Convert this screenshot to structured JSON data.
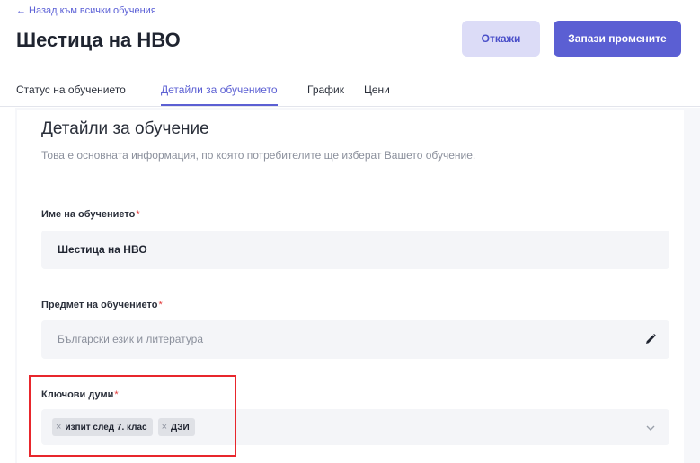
{
  "header": {
    "back_link": "← Назад към всички обучения",
    "title": "Шестица на НВО",
    "cancel_label": "Откажи",
    "save_label": "Запази промените"
  },
  "tabs": [
    {
      "label": "Статус на обучението",
      "active": false
    },
    {
      "label": "Детайли за обучението",
      "active": true
    },
    {
      "label": "График",
      "active": false
    },
    {
      "label": "Цени",
      "active": false
    }
  ],
  "section": {
    "title": "Детайли за обучение",
    "description": "Това е основната информация, по която потребителите ще изберат Вашето обучение."
  },
  "fields": {
    "name": {
      "label": "Име на обучението",
      "required_mark": "*",
      "value": "Шестица на НВО"
    },
    "subject": {
      "label": "Предмет на обучението",
      "required_mark": "*",
      "value": "Български език и литература",
      "icon": "pencil-icon"
    },
    "keywords": {
      "label": "Ключови думи",
      "required_mark": "*",
      "tags": [
        "изпит след 7. клас",
        "ДЗИ"
      ],
      "tag_remove_glyph": "×",
      "icon": "chevron-down-icon"
    }
  },
  "colors": {
    "accent": "#5b5fd3",
    "cancel_bg": "#dcdcf7",
    "required": "#e23b3b",
    "highlight_border": "#e8262c"
  }
}
